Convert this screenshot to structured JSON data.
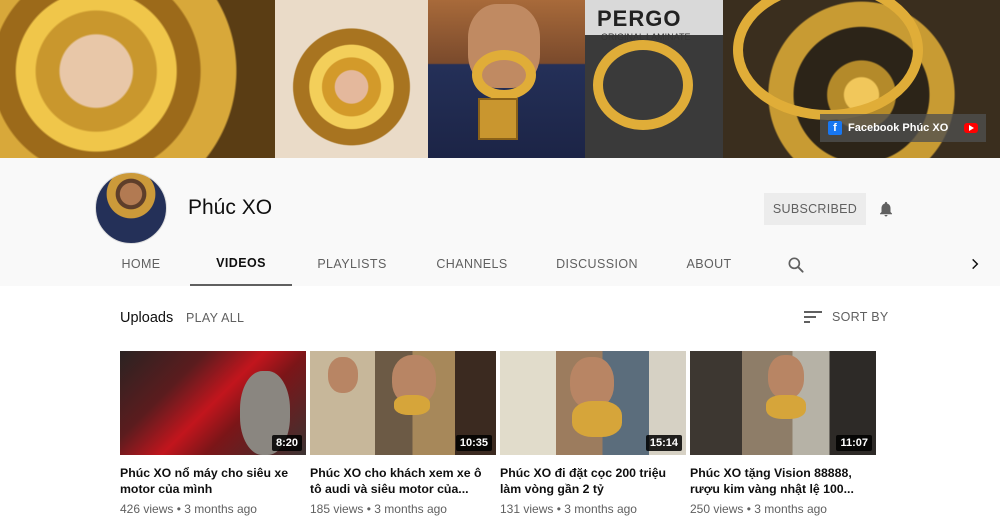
{
  "banner": {
    "brand_sign": "PERGO",
    "brand_sub": "ORIGINAL LAMINATE",
    "social_link_label": "Facebook Phúc XO"
  },
  "channel": {
    "name": "Phúc XO",
    "subscribe_label": "SUBSCRIBED"
  },
  "tabs": [
    {
      "label": "HOME",
      "active": false
    },
    {
      "label": "VIDEOS",
      "active": true
    },
    {
      "label": "PLAYLISTS",
      "active": false
    },
    {
      "label": "CHANNELS",
      "active": false
    },
    {
      "label": "DISCUSSION",
      "active": false
    },
    {
      "label": "ABOUT",
      "active": false
    }
  ],
  "uploads": {
    "title": "Uploads",
    "play_all": "PLAY ALL",
    "sort_label": "SORT BY"
  },
  "videos": [
    {
      "title": "Phúc XO nổ máy cho siêu xe motor của mình",
      "duration": "8:20",
      "views": "426 views",
      "age": "3 months ago"
    },
    {
      "title": "Phúc XO cho khách xem xe ô tô audi và siêu motor của...",
      "duration": "10:35",
      "views": "185 views",
      "age": "3 months ago"
    },
    {
      "title": "Phúc XO đi đặt cọc 200 triệu làm vòng gần 2 tỷ",
      "duration": "15:14",
      "views": "131 views",
      "age": "3 months ago"
    },
    {
      "title": "Phúc XO tặng Vision 88888, rượu kim vàng nhật lệ 100...",
      "duration": "11:07",
      "views": "250 views",
      "age": "3 months ago"
    }
  ],
  "meta_separator": "•",
  "icons": {
    "bell": "bell-icon",
    "search": "search-icon",
    "sort": "sort-icon",
    "next": "chevron-right-icon",
    "facebook": "facebook-icon",
    "youtube": "youtube-icon"
  },
  "colors": {
    "header_bg": "#f9f9f9",
    "text_secondary": "#606060",
    "subscribed_bg": "#ececec",
    "facebook_blue": "#1877f2",
    "youtube_red": "#ff0000"
  }
}
